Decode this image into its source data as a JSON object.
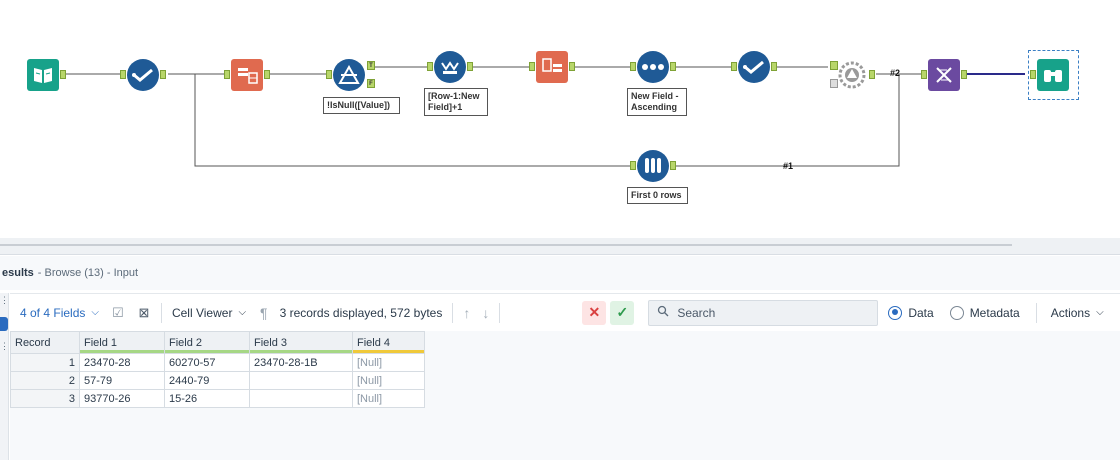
{
  "canvas": {
    "annotations": {
      "formula_isnull": "!IsNull([Value])",
      "multirow": "[Row-1:New Field]+1",
      "sort": "New Field - Ascending",
      "sample": "First 0 rows"
    },
    "wire_labels": {
      "w2": "#2",
      "w1": "#1"
    },
    "tf_labels": {
      "t": "T",
      "f": "F"
    },
    "colors": {
      "tool_blue": "#1f5a96",
      "tool_teal": "#17a28a",
      "tool_orange": "#e06a4f",
      "tool_purple": "#6b4aa0",
      "tool_gray": "#9a9a9a",
      "anchor_green": "#b8d66a",
      "wire": "#555555",
      "wire_blue": "#2a2a8a"
    }
  },
  "results": {
    "title": "esults",
    "subtitle": "- Browse (13) - Input"
  },
  "toolbar": {
    "fields_label": "4 of 4 Fields",
    "viewer_label": "Cell Viewer",
    "records_info": "3 records displayed, 572 bytes",
    "search_placeholder": "Search",
    "radio_data": "Data",
    "radio_metadata": "Metadata",
    "actions_label": "Actions"
  },
  "grid": {
    "headers": [
      "Record",
      "Field 1",
      "Field 2",
      "Field 3",
      "Field 4"
    ],
    "header_bar_colors": [
      "",
      "#a6d785",
      "#a6d785",
      "#a6d785",
      "#f0c93a"
    ],
    "rows": [
      [
        "1",
        "23470-28",
        "60270-57",
        "23470-28-1B",
        "[Null]"
      ],
      [
        "2",
        "57-79",
        "2440-79",
        "",
        "[Null]"
      ],
      [
        "3",
        "93770-26",
        "15-26",
        "",
        "[Null]"
      ]
    ]
  }
}
